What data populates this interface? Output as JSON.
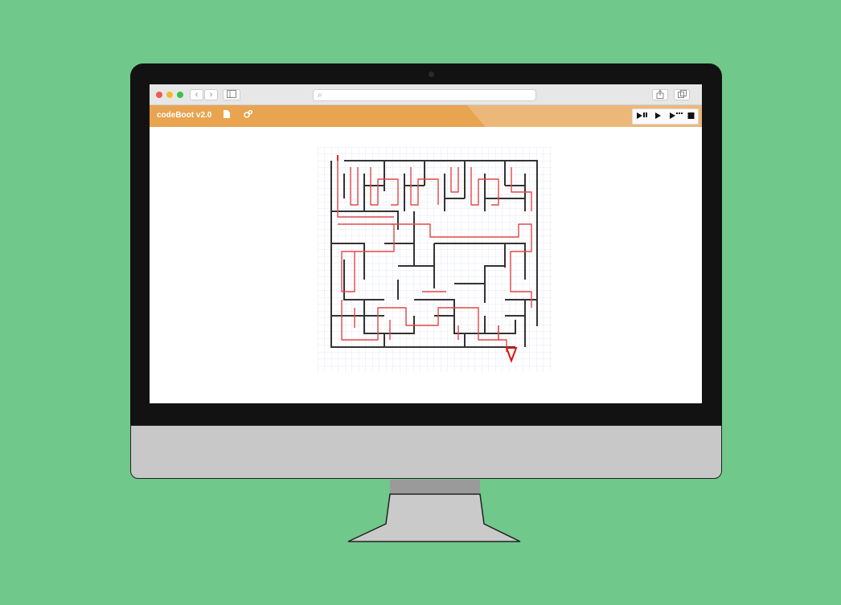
{
  "app": {
    "title": "codeBoot v2.0",
    "icons": [
      "file-icon",
      "settings-icon"
    ]
  },
  "browser": {
    "window_buttons": [
      "close",
      "minimize",
      "maximize"
    ],
    "url_placeholder": ""
  },
  "controls": {
    "items": [
      "step-icon",
      "play-icon",
      "animate-icon",
      "stop-icon"
    ]
  },
  "colors": {
    "background": "#70c88b",
    "app_bar": "#e8a450",
    "maze_wall": "#333333",
    "path": "#e01010"
  }
}
